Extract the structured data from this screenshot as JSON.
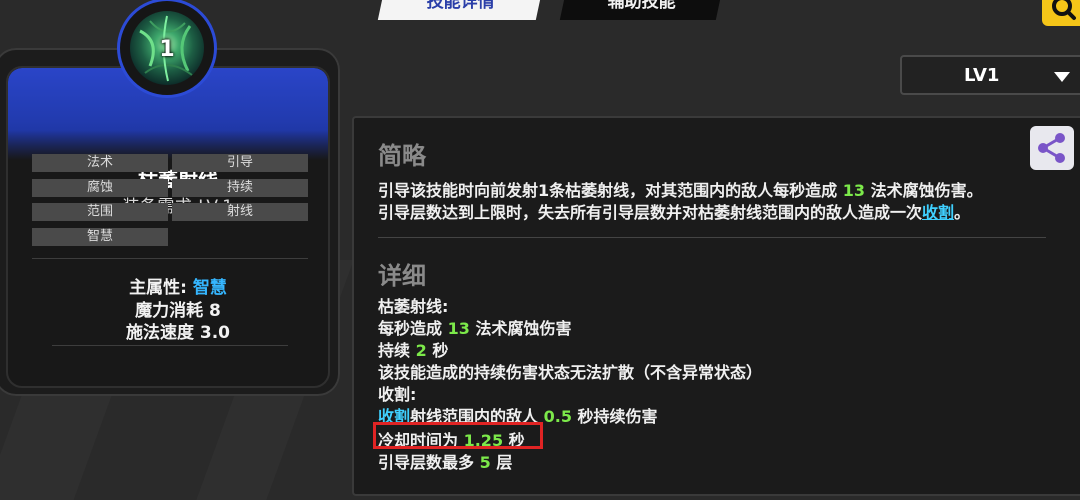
{
  "tabs": {
    "active_label": "技能详情",
    "inactive_label": "辅助技能"
  },
  "search": {
    "icon": "search-icon",
    "color": "#f5c518"
  },
  "level_select": {
    "value": "LV1"
  },
  "skill_card": {
    "level_badge": "1",
    "name": "枯萎射线",
    "requirement": "装备需求 LV.1",
    "tags": [
      "法术",
      "引导",
      "腐蚀",
      "持续",
      "范围",
      "射线",
      "智慧"
    ],
    "main_attr_label": "主属性:",
    "main_attr_value": "智慧",
    "mana_cost": "魔力消耗 8",
    "cast_speed": "施法速度 3.0",
    "header_color": "#2a45c8"
  },
  "summary": {
    "title": "简略",
    "line1_prefix": "引导该技能时向前发射1条枯萎射线，对其范围内的敌人每秒造成",
    "line1_num": "13",
    "line1_suffix": "法术腐蚀伤害。",
    "line2_prefix": "引导层数达到上限时，失去所有引导层数并对枯萎射线范围内的敌人造成一次",
    "line2_kw": "收割",
    "line2_suffix": "。"
  },
  "detail": {
    "title": "详细",
    "l1": "枯萎射线:",
    "l2_prefix": "每秒造成",
    "l2_num": "13",
    "l2_suffix": "法术腐蚀伤害",
    "l3_prefix": "持续",
    "l3_num": "2",
    "l3_suffix": "秒",
    "l4": "该技能造成的持续伤害状态无法扩散（不含异常状态）",
    "l5": "收割:",
    "l6_kw": "收割",
    "l6_mid": "射线范围内的敌人",
    "l6_num": "0.5",
    "l6_suffix": "秒持续伤害",
    "l7_prefix": "冷却时间为",
    "l7_num": "1.25",
    "l7_suffix": "秒",
    "l8_prefix": "引导层数最多",
    "l8_num": "5",
    "l8_suffix": "层"
  },
  "colors": {
    "number": "#7ce94a",
    "keyword": "#3fd0ff",
    "highlight": "#e02424"
  }
}
